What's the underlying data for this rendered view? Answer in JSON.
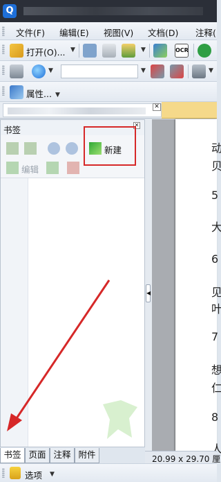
{
  "app": {
    "logo_glyph": "Q"
  },
  "menu": {
    "items": [
      {
        "label": "文件(F)"
      },
      {
        "label": "编辑(E)"
      },
      {
        "label": "视图(V)"
      },
      {
        "label": "文档(D)"
      },
      {
        "label": "注释("
      }
    ]
  },
  "toolbar1": {
    "open_label": "打开(O)...",
    "ocr_label": "OCR"
  },
  "toolbar2": {
    "address_value": ""
  },
  "toolbar3": {
    "properties_label": "属性..."
  },
  "doc_tab": {
    "close_glyph": "✕"
  },
  "bookmark_panel": {
    "title": "书签",
    "close_glyph": "✕",
    "new_label": "新建",
    "edit_label": "编辑"
  },
  "bottom_tabs": [
    {
      "label": "书签"
    },
    {
      "label": "页面"
    },
    {
      "label": "注释"
    },
    {
      "label": "附件"
    }
  ],
  "document": {
    "lines": [
      "动",
      "贝",
      "5",
      "大",
      "6",
      "见",
      "叶",
      "7",
      "想",
      "仁",
      "8",
      "人"
    ]
  },
  "status": {
    "page_size": "20.99 x 29.70 厘"
  },
  "bottom_bar": {
    "options_label": "选项"
  },
  "colors": {
    "annotation_red": "#d62828",
    "accent_blue": "#1e6fd8"
  }
}
